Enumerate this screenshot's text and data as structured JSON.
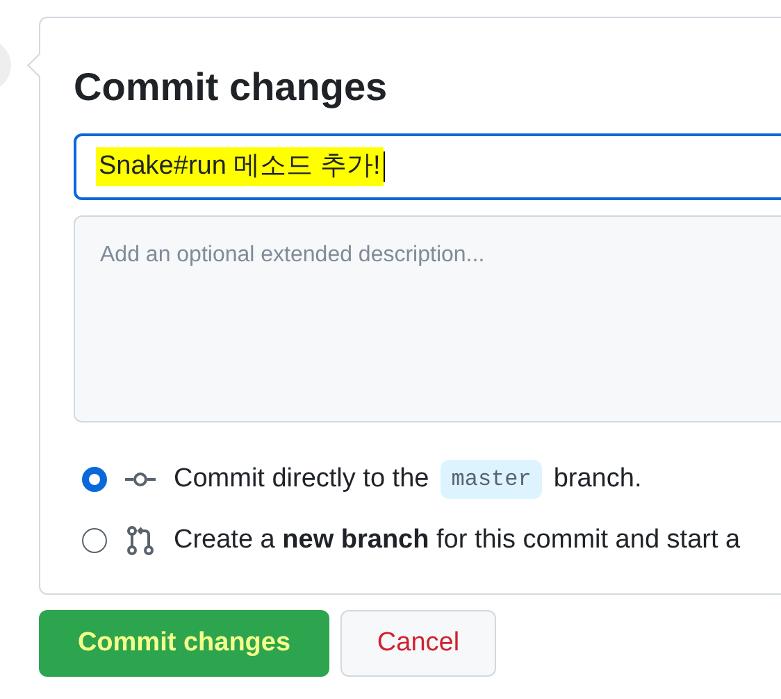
{
  "title": "Commit changes",
  "message": {
    "value": "Snake#run 메소드 추가!"
  },
  "description": {
    "placeholder": "Add an optional extended description..."
  },
  "options": [
    {
      "kind": "direct",
      "selected": true,
      "label_before": "Commit directly to the",
      "branch": "master",
      "label_after": "branch."
    },
    {
      "kind": "new",
      "selected": false,
      "label": "Create a **new branch** for this commit and start a"
    }
  ],
  "buttons": [
    {
      "kind": "primary",
      "label": "Commit changes"
    },
    {
      "kind": "cancel",
      "label": "Cancel"
    }
  ]
}
